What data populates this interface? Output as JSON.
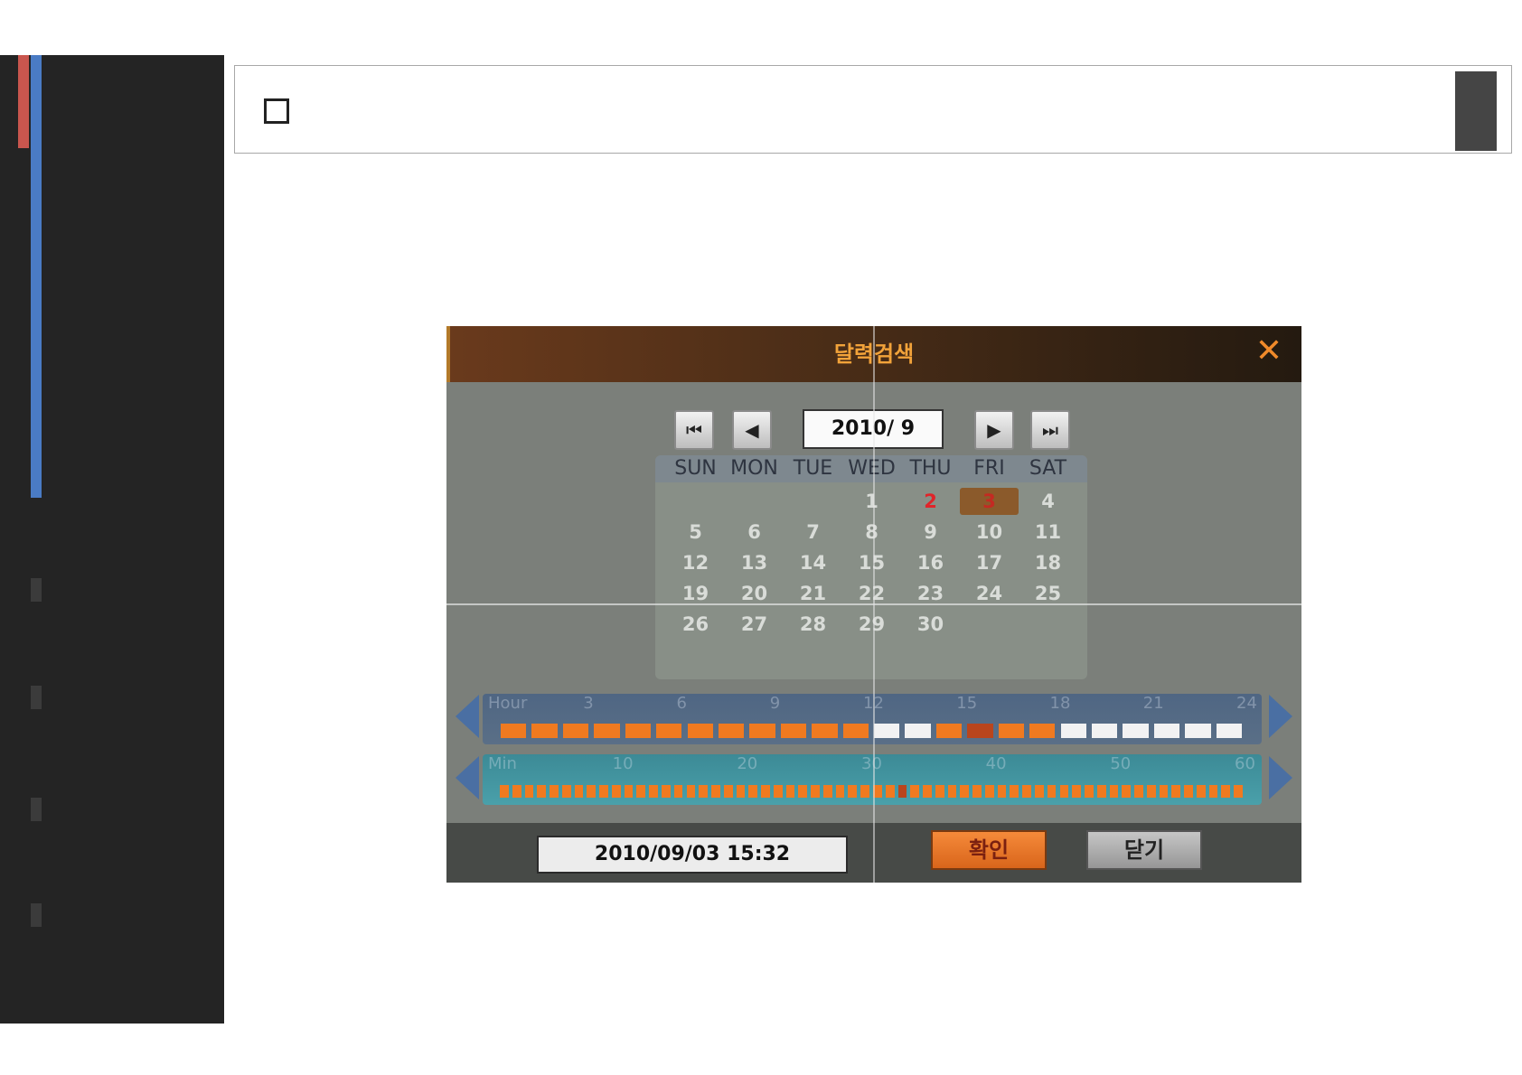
{
  "dialog": {
    "title": "달력검색",
    "close_icon": "close-icon",
    "month_label": "2010/ 9",
    "nav": [
      "first-icon",
      "prev-icon",
      "next-icon",
      "last-icon"
    ],
    "nav_glyphs": [
      "⏮",
      "◀",
      "▶",
      "⏭"
    ],
    "weekdays": [
      "SUN",
      "MON",
      "TUE",
      "WED",
      "THU",
      "FRI",
      "SAT"
    ],
    "weeks": [
      [
        "",
        "",
        "",
        "1",
        "2",
        "3",
        "4"
      ],
      [
        "5",
        "6",
        "7",
        "8",
        "9",
        "10",
        "11"
      ],
      [
        "12",
        "13",
        "14",
        "15",
        "16",
        "17",
        "18"
      ],
      [
        "19",
        "20",
        "21",
        "22",
        "23",
        "24",
        "25"
      ],
      [
        "26",
        "27",
        "28",
        "29",
        "30",
        "",
        ""
      ]
    ],
    "highlight_days": [
      "2"
    ],
    "selected_day": "3",
    "hour_bar": {
      "label": "Hour",
      "ticks": [
        "3",
        "6",
        "9",
        "12",
        "15",
        "18",
        "21",
        "24"
      ],
      "segments": [
        "rec",
        "rec",
        "rec",
        "rec",
        "rec",
        "rec",
        "rec",
        "rec",
        "rec",
        "rec",
        "rec",
        "rec",
        "none",
        "none",
        "rec",
        "sel",
        "rec",
        "rec",
        "none",
        "none",
        "none",
        "none",
        "none",
        "none"
      ]
    },
    "min_bar": {
      "label": "Min",
      "ticks": [
        "10",
        "20",
        "30",
        "40",
        "50",
        "60"
      ],
      "selected_minute": 32
    },
    "datetime": "2010/09/03 15:32",
    "ok_label": "확인",
    "close_label": "닫기",
    "colors": {
      "record": "#f07a20",
      "none": "#f2f2f2",
      "selected": "#b9451d",
      "accent": "#f2a33a"
    }
  }
}
